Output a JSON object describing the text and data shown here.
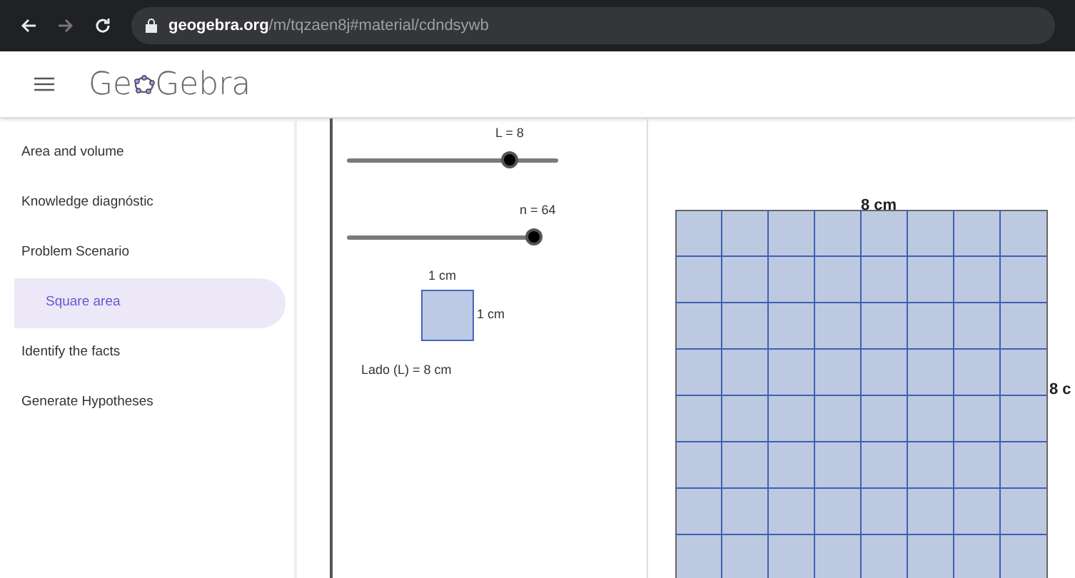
{
  "browser": {
    "url_host": "geogebra.org",
    "url_path": "/m/tqzaen8j#material/cdndsywb"
  },
  "header": {
    "logo_left": "Ge",
    "logo_right": "Gebra"
  },
  "sidebar": {
    "items": [
      {
        "label": "Area and volume",
        "selected": false
      },
      {
        "label": "Knowledge diagnóstic",
        "selected": false
      },
      {
        "label": "Problem Scenario",
        "selected": false,
        "children": [
          {
            "label": "Square area",
            "selected": true
          }
        ]
      },
      {
        "label": "Identify the facts",
        "selected": false
      },
      {
        "label": "Generate Hypotheses",
        "selected": false
      }
    ]
  },
  "applet": {
    "sliders": [
      {
        "label": "L = 8",
        "level": 0.77
      },
      {
        "label": "n = 64",
        "level": 1
      }
    ],
    "unit_square": {
      "top_label": "1 cm",
      "side_label": "1 cm"
    },
    "side_text": "Lado (L) = 8 cm"
  },
  "graphic": {
    "top_label": "8 cm",
    "side_label": "8 c"
  }
}
